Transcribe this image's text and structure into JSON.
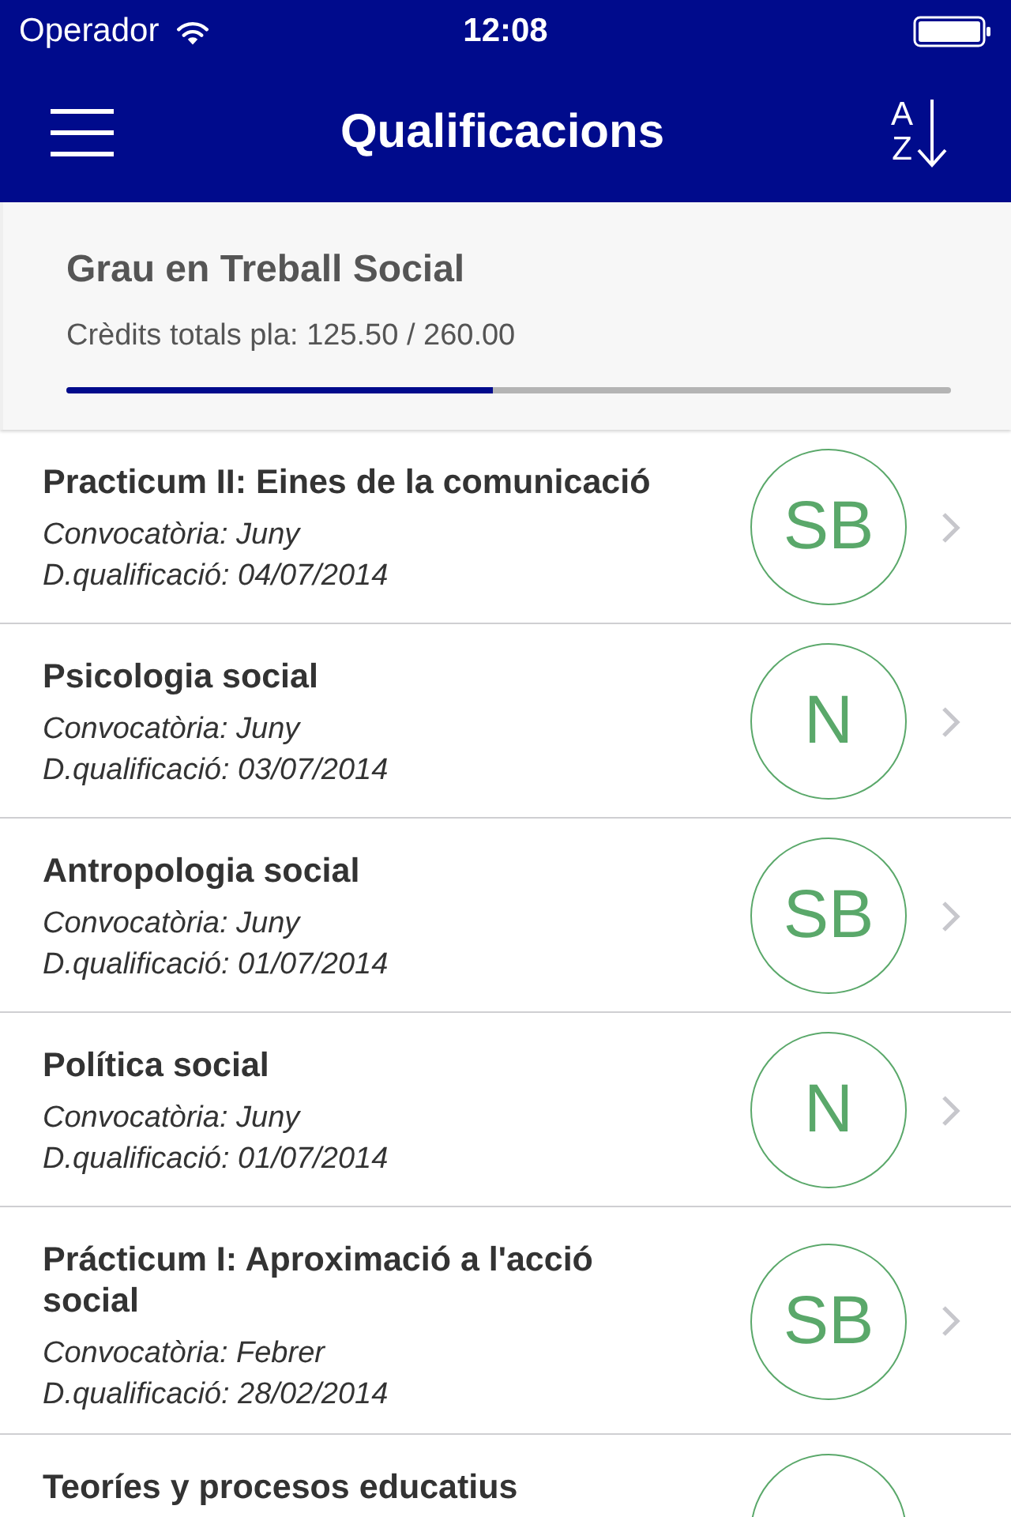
{
  "status_bar": {
    "carrier": "Operador",
    "time": "12:08"
  },
  "nav_bar": {
    "title": "Qualificacions",
    "sort_button": {
      "top": "A",
      "bottom": "Z"
    }
  },
  "plan": {
    "title": "Grau en Treball Social",
    "credits": "Crèdits totals pla: 125.50 / 260.00",
    "level": 0.483
  },
  "subjects": [
    {
      "title": "Practicum II: Eines de la comunicació",
      "session": "Convocatòria: Juny",
      "date": "D.qualificació: 04/07/2014",
      "grade": "SB"
    },
    {
      "title": "Psicologia social",
      "session": "Convocatòria: Juny",
      "date": "D.qualificació: 03/07/2014",
      "grade": "N"
    },
    {
      "title": "Antropologia social",
      "session": "Convocatòria: Juny",
      "date": "D.qualificació: 01/07/2014",
      "grade": "SB"
    },
    {
      "title": "Política social",
      "session": "Convocatòria: Juny",
      "date": "D.qualificació: 01/07/2014",
      "grade": "N"
    },
    {
      "title": "Prácticum I: Aproximació a l'acció social",
      "session": "Convocatòria: Febrer",
      "date": "D.qualificació: 28/02/2014",
      "grade": "SB"
    },
    {
      "title": "Teoríes y procesos educatius"
    }
  ]
}
